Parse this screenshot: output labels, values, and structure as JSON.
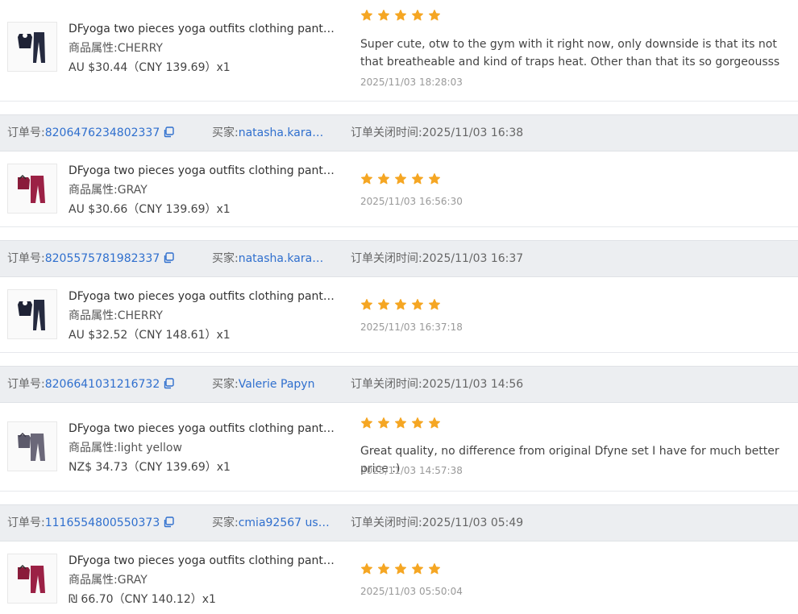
{
  "labels": {
    "order_no": "订单号:",
    "buyer": "买家:",
    "close_time": "订单关闭时间:",
    "attr": "商品属性:"
  },
  "colors": {
    "star": "#f5a623",
    "link": "#2f6fce",
    "order_bar": "#eceef1"
  },
  "products": [
    {
      "title": "DFyoga two pieces yoga outfits clothing pants se...",
      "attr_value": "CHERRY",
      "price": "AU $30.44（CNY  139.69）x1",
      "rating": 5,
      "review_text": "Super cute, otw to the gym with it right now, only downside is that its not that breatheable and kind of traps heat. Other than that its so gorgeousss",
      "review_time": "2025/11/03 18:28:03",
      "thumb_color": "navy"
    },
    {
      "title": "DFyoga two pieces yoga outfits clothing pants se...",
      "attr_value": "GRAY",
      "price": "AU $30.66（CNY  139.69）x1",
      "rating": 5,
      "review_text": "",
      "review_time": "2025/11/03 16:56:30",
      "thumb_color": "maroon"
    },
    {
      "title": "DFyoga two pieces yoga outfits clothing pants se...",
      "attr_value": "CHERRY",
      "price": "AU $32.52（CNY  148.61）x1",
      "rating": 5,
      "review_text": "",
      "review_time": "2025/11/03 16:37:18",
      "thumb_color": "navy"
    },
    {
      "title": "DFyoga two pieces yoga outfits clothing pants se...",
      "attr_value": "light yellow",
      "price": "NZ$ 34.73（CNY  139.69）x1",
      "rating": 5,
      "review_text": "Great quality, no difference from original Dfyne set I have for much better price :)",
      "review_time": "2025/11/03 14:57:38",
      "thumb_color": "slate"
    },
    {
      "title": "DFyoga two pieces yoga outfits clothing pants se...",
      "attr_value": "GRAY",
      "price": "₪ 66.70（CNY  140.12）x1",
      "rating": 5,
      "review_text": "",
      "review_time": "2025/11/03 05:50:04",
      "thumb_color": "maroon"
    }
  ],
  "orders": [
    {
      "order_no": "8206476234802337",
      "buyer": "natasha.karam0...",
      "close_time": "2025/11/03 16:38"
    },
    {
      "order_no": "8205575781982337",
      "buyer": "natasha.karam0...",
      "close_time": "2025/11/03 16:37"
    },
    {
      "order_no": "8206641031216732",
      "buyer": "Valerie Papyn",
      "close_time": "2025/11/03 14:56"
    },
    {
      "order_no": "1116554800550373",
      "buyer": "cmia92567 user...",
      "close_time": "2025/11/03 05:49"
    }
  ]
}
